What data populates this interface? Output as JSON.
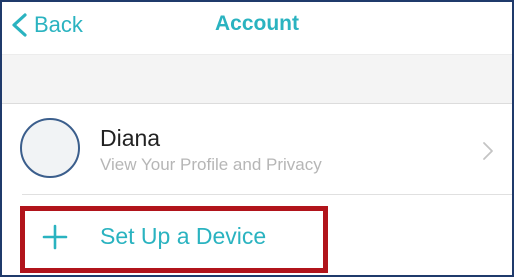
{
  "navbar": {
    "back_label": "Back",
    "title": "Account"
  },
  "profile": {
    "name": "Diana",
    "subtitle": "View Your Profile and Privacy"
  },
  "device_row": {
    "label": "Set Up a Device",
    "icon": "plus-icon"
  },
  "colors": {
    "accent": "#2ab3c0",
    "highlight": "#b1141b",
    "avatar_border": "#3b5e8c"
  }
}
